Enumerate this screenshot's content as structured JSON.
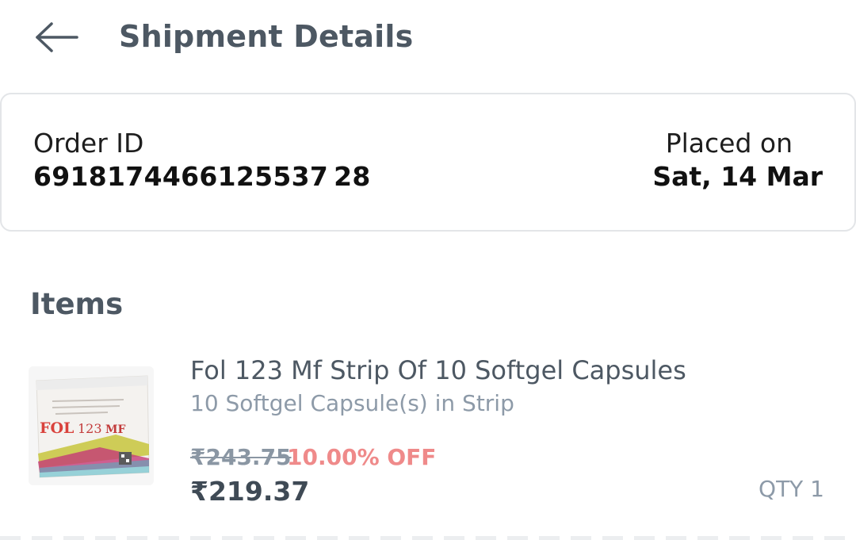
{
  "header": {
    "back_icon": "arrow-left-icon",
    "title": "Shipment Details"
  },
  "order": {
    "id_label": "Order ID",
    "id_value": "6918174466125537 28",
    "placed_label": "Placed on",
    "placed_value": "Sat, 14 Mar"
  },
  "items": {
    "heading": "Items",
    "list": [
      {
        "name": "Fol 123 Mf Strip Of 10 Softgel Capsules",
        "pack": "10 Softgel Capsule(s) in Strip",
        "mrp": "₹243.75",
        "discount": "10.00% OFF",
        "price": "₹219.37",
        "qty": "QTY 1",
        "image_icon": "product-box-image"
      }
    ]
  },
  "colors": {
    "title": "#4d5863",
    "discount": "#ef8a8a",
    "muted": "#8d9aa8"
  }
}
